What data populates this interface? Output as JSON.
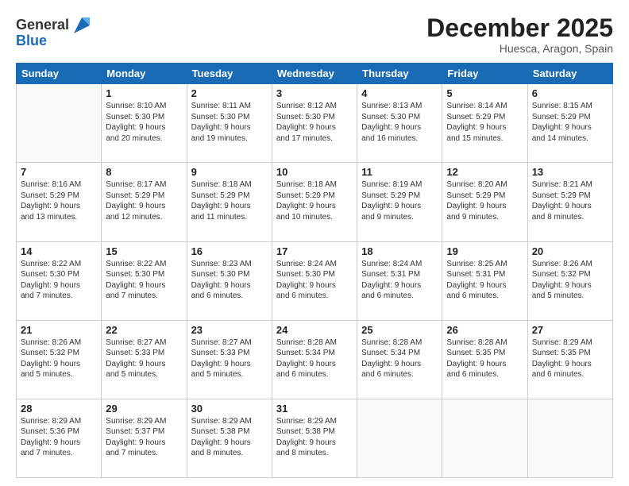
{
  "header": {
    "logo_line1": "General",
    "logo_line2": "Blue",
    "month": "December 2025",
    "location": "Huesca, Aragon, Spain"
  },
  "weekdays": [
    "Sunday",
    "Monday",
    "Tuesday",
    "Wednesday",
    "Thursday",
    "Friday",
    "Saturday"
  ],
  "weeks": [
    [
      {
        "day": "",
        "info": ""
      },
      {
        "day": "1",
        "info": "Sunrise: 8:10 AM\nSunset: 5:30 PM\nDaylight: 9 hours\nand 20 minutes."
      },
      {
        "day": "2",
        "info": "Sunrise: 8:11 AM\nSunset: 5:30 PM\nDaylight: 9 hours\nand 19 minutes."
      },
      {
        "day": "3",
        "info": "Sunrise: 8:12 AM\nSunset: 5:30 PM\nDaylight: 9 hours\nand 17 minutes."
      },
      {
        "day": "4",
        "info": "Sunrise: 8:13 AM\nSunset: 5:30 PM\nDaylight: 9 hours\nand 16 minutes."
      },
      {
        "day": "5",
        "info": "Sunrise: 8:14 AM\nSunset: 5:29 PM\nDaylight: 9 hours\nand 15 minutes."
      },
      {
        "day": "6",
        "info": "Sunrise: 8:15 AM\nSunset: 5:29 PM\nDaylight: 9 hours\nand 14 minutes."
      }
    ],
    [
      {
        "day": "7",
        "info": "Sunrise: 8:16 AM\nSunset: 5:29 PM\nDaylight: 9 hours\nand 13 minutes."
      },
      {
        "day": "8",
        "info": "Sunrise: 8:17 AM\nSunset: 5:29 PM\nDaylight: 9 hours\nand 12 minutes."
      },
      {
        "day": "9",
        "info": "Sunrise: 8:18 AM\nSunset: 5:29 PM\nDaylight: 9 hours\nand 11 minutes."
      },
      {
        "day": "10",
        "info": "Sunrise: 8:18 AM\nSunset: 5:29 PM\nDaylight: 9 hours\nand 10 minutes."
      },
      {
        "day": "11",
        "info": "Sunrise: 8:19 AM\nSunset: 5:29 PM\nDaylight: 9 hours\nand 9 minutes."
      },
      {
        "day": "12",
        "info": "Sunrise: 8:20 AM\nSunset: 5:29 PM\nDaylight: 9 hours\nand 9 minutes."
      },
      {
        "day": "13",
        "info": "Sunrise: 8:21 AM\nSunset: 5:29 PM\nDaylight: 9 hours\nand 8 minutes."
      }
    ],
    [
      {
        "day": "14",
        "info": "Sunrise: 8:22 AM\nSunset: 5:30 PM\nDaylight: 9 hours\nand 7 minutes."
      },
      {
        "day": "15",
        "info": "Sunrise: 8:22 AM\nSunset: 5:30 PM\nDaylight: 9 hours\nand 7 minutes."
      },
      {
        "day": "16",
        "info": "Sunrise: 8:23 AM\nSunset: 5:30 PM\nDaylight: 9 hours\nand 6 minutes."
      },
      {
        "day": "17",
        "info": "Sunrise: 8:24 AM\nSunset: 5:30 PM\nDaylight: 9 hours\nand 6 minutes."
      },
      {
        "day": "18",
        "info": "Sunrise: 8:24 AM\nSunset: 5:31 PM\nDaylight: 9 hours\nand 6 minutes."
      },
      {
        "day": "19",
        "info": "Sunrise: 8:25 AM\nSunset: 5:31 PM\nDaylight: 9 hours\nand 6 minutes."
      },
      {
        "day": "20",
        "info": "Sunrise: 8:26 AM\nSunset: 5:32 PM\nDaylight: 9 hours\nand 5 minutes."
      }
    ],
    [
      {
        "day": "21",
        "info": "Sunrise: 8:26 AM\nSunset: 5:32 PM\nDaylight: 9 hours\nand 5 minutes."
      },
      {
        "day": "22",
        "info": "Sunrise: 8:27 AM\nSunset: 5:33 PM\nDaylight: 9 hours\nand 5 minutes."
      },
      {
        "day": "23",
        "info": "Sunrise: 8:27 AM\nSunset: 5:33 PM\nDaylight: 9 hours\nand 5 minutes."
      },
      {
        "day": "24",
        "info": "Sunrise: 8:28 AM\nSunset: 5:34 PM\nDaylight: 9 hours\nand 6 minutes."
      },
      {
        "day": "25",
        "info": "Sunrise: 8:28 AM\nSunset: 5:34 PM\nDaylight: 9 hours\nand 6 minutes."
      },
      {
        "day": "26",
        "info": "Sunrise: 8:28 AM\nSunset: 5:35 PM\nDaylight: 9 hours\nand 6 minutes."
      },
      {
        "day": "27",
        "info": "Sunrise: 8:29 AM\nSunset: 5:35 PM\nDaylight: 9 hours\nand 6 minutes."
      }
    ],
    [
      {
        "day": "28",
        "info": "Sunrise: 8:29 AM\nSunset: 5:36 PM\nDaylight: 9 hours\nand 7 minutes."
      },
      {
        "day": "29",
        "info": "Sunrise: 8:29 AM\nSunset: 5:37 PM\nDaylight: 9 hours\nand 7 minutes."
      },
      {
        "day": "30",
        "info": "Sunrise: 8:29 AM\nSunset: 5:38 PM\nDaylight: 9 hours\nand 8 minutes."
      },
      {
        "day": "31",
        "info": "Sunrise: 8:29 AM\nSunset: 5:38 PM\nDaylight: 9 hours\nand 8 minutes."
      },
      {
        "day": "",
        "info": ""
      },
      {
        "day": "",
        "info": ""
      },
      {
        "day": "",
        "info": ""
      }
    ]
  ]
}
